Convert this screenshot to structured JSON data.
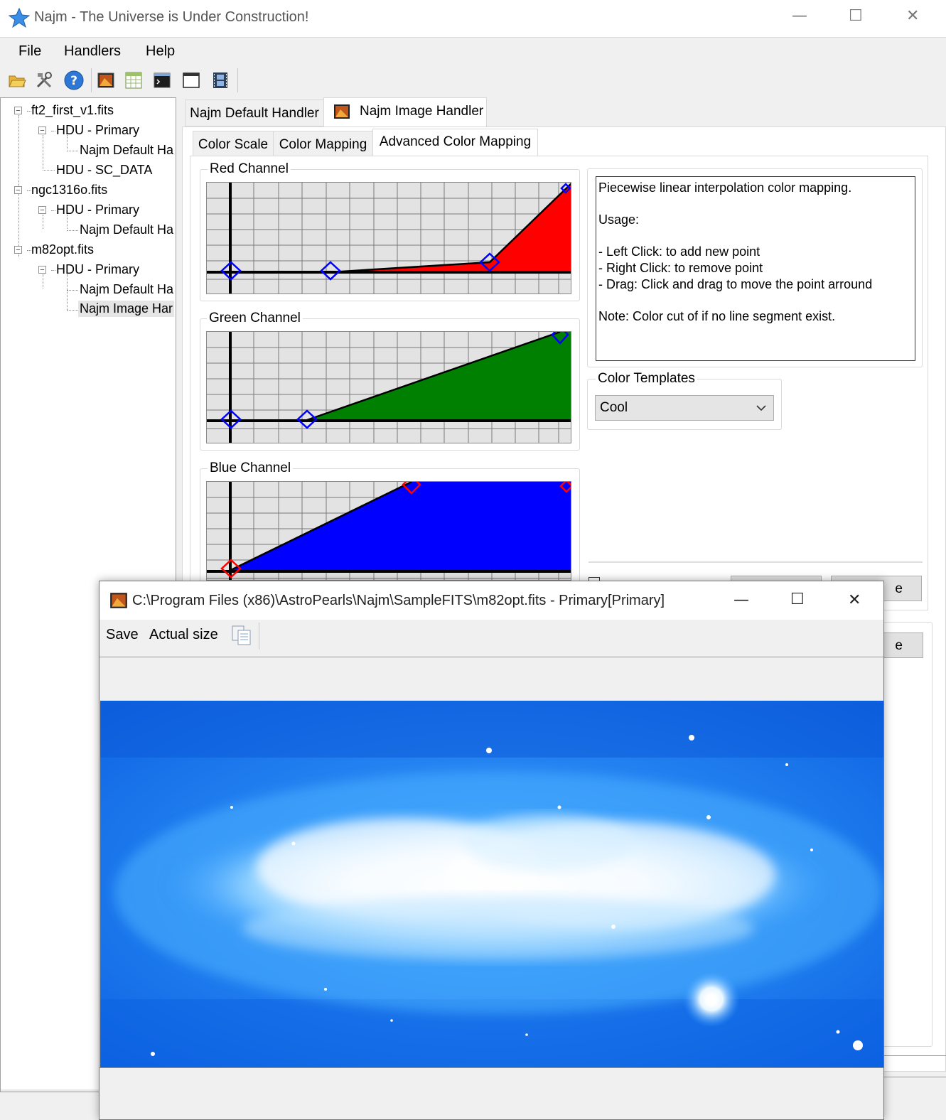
{
  "app": {
    "title": "Najm - The Universe is Under Construction!",
    "window_controls": {
      "minimize": "—",
      "maximize": "☐",
      "close": "✕"
    }
  },
  "menu": [
    "File",
    "Handlers",
    "Help"
  ],
  "toolbar": {
    "icons": [
      "open-folder-icon",
      "tools-icon",
      "help-icon",
      "image-icon",
      "table-icon",
      "console-icon",
      "window-icon",
      "film-icon"
    ]
  },
  "tree": {
    "items": [
      {
        "label": "ft2_first_v1.fits"
      },
      {
        "label": "HDU - Primary"
      },
      {
        "label": "Najm Default Ha"
      },
      {
        "label": "HDU - SC_DATA"
      },
      {
        "label": "ngc1316o.fits"
      },
      {
        "label": "HDU - Primary"
      },
      {
        "label": "Najm Default Ha"
      },
      {
        "label": "m82opt.fits"
      },
      {
        "label": "HDU - Primary"
      },
      {
        "label": "Najm Default Ha"
      },
      {
        "label": "Najm Image Har"
      }
    ],
    "scroll_left": "<"
  },
  "handler_tabs": [
    "Najm Default Handler",
    "Najm Image Handler"
  ],
  "sub_tabs": [
    "Color Scale",
    "Color Mapping",
    "Advanced Color Mapping"
  ],
  "channels": {
    "red": {
      "label": "Red Channel",
      "color": "#ff0000",
      "point_color": "#0000ff"
    },
    "green": {
      "label": "Green Channel",
      "color": "#008000",
      "point_color": "#0000ff"
    },
    "blue": {
      "label": "Blue Channel",
      "color": "#0000ff",
      "point_color": "#ff0000"
    }
  },
  "info": {
    "line1": "Piecewise linear interpolation color mapping.",
    "usage": "Usage:",
    "left": "- Left Click: to add new point",
    "right": "- Right Click: to remove point",
    "drag": "- Drag: Click and drag to move the point arround",
    "note": "Note: Color cut of if no line segment exist."
  },
  "templates": {
    "label": "Color Templates",
    "selected": "Cool"
  },
  "partial_buttons": [
    "e",
    "e"
  ],
  "child_window": {
    "title": "C:\\Program Files (x86)\\AstroPearls\\Najm\\SampleFITS\\m82opt.fits - Primary[Primary]",
    "save": "Save",
    "actual_size": "Actual size",
    "copy_icon": "copy-icon",
    "controls": {
      "minimize": "—",
      "maximize": "☐",
      "close": "✕"
    }
  }
}
